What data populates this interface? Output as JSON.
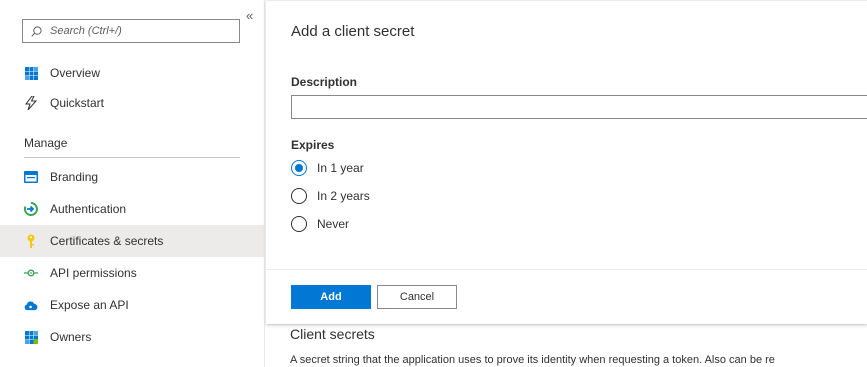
{
  "sidebar": {
    "search_placeholder": "Search (Ctrl+/)",
    "collapse_glyph": "«",
    "top_items": [
      {
        "label": "Overview",
        "icon": "overview-grid-icon"
      },
      {
        "label": "Quickstart",
        "icon": "quickstart-lightning-icon"
      }
    ],
    "section_title": "Manage",
    "manage_items": [
      {
        "label": "Branding",
        "icon": "branding-icon"
      },
      {
        "label": "Authentication",
        "icon": "authentication-icon"
      },
      {
        "label": "Certificates & secrets",
        "icon": "key-icon",
        "active": true
      },
      {
        "label": "API permissions",
        "icon": "api-permissions-icon"
      },
      {
        "label": "Expose an API",
        "icon": "cloud-icon"
      },
      {
        "label": "Owners",
        "icon": "owners-grid-icon"
      }
    ]
  },
  "panel": {
    "title": "Add a client secret",
    "description_label": "Description",
    "description_value": "",
    "expires_label": "Expires",
    "expires_options": [
      {
        "label": "In 1 year",
        "checked": true
      },
      {
        "label": "In 2 years",
        "checked": false
      },
      {
        "label": "Never",
        "checked": false
      }
    ],
    "add_label": "Add",
    "cancel_label": "Cancel"
  },
  "background": {
    "section_title": "Client secrets",
    "description": "A secret string that the application uses to prove its identity when requesting a token. Also can be re"
  },
  "colors": {
    "accent": "#0078d4",
    "active_row": "#edebe9",
    "text": "#323130"
  }
}
